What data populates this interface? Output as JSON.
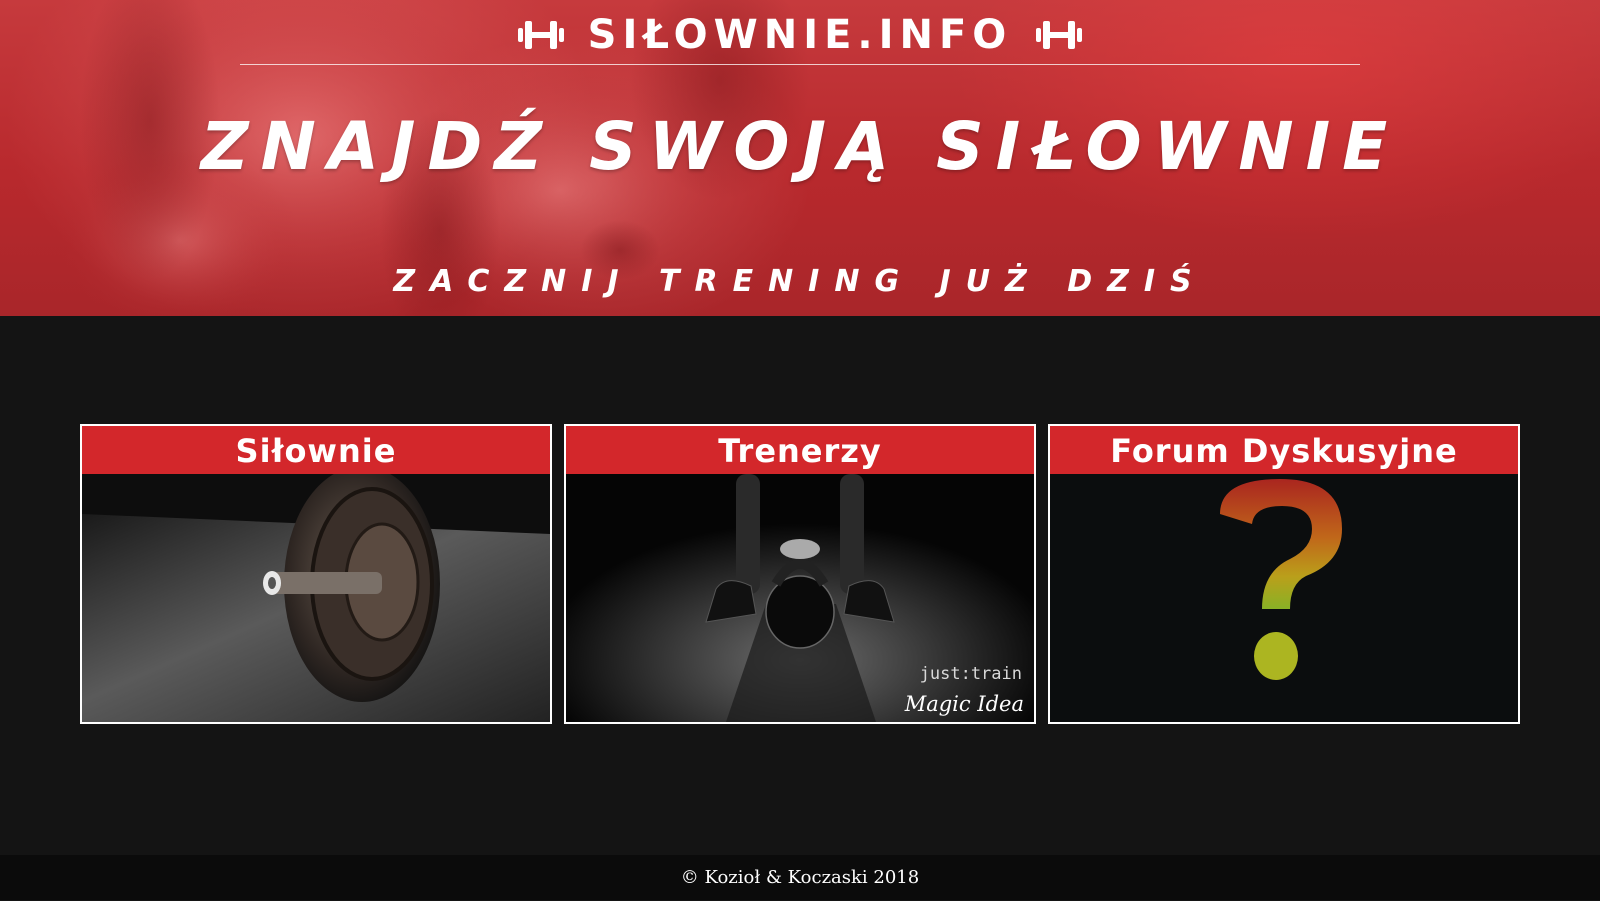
{
  "header": {
    "brand": "SIŁOWNIE.INFO",
    "brand_icon_left": "dumbbell-icon",
    "brand_icon_right": "dumbbell-icon",
    "title": "ZNAJDŹ SWOJĄ SIŁOWNIE",
    "subtitle": "ZACZNIJ TRENING JUŻ DZIŚ"
  },
  "cards": [
    {
      "title": "Siłownie",
      "image": "weight-plate-photo"
    },
    {
      "title": "Trenerzy",
      "image": "kettlebell-photo",
      "watermark_top": "just:train",
      "watermark_bottom": "Magic Idea"
    },
    {
      "title": "Forum Dyskusyjne",
      "image": "question-mark-word-cloud"
    }
  ],
  "footer": {
    "text": "© Kozioł & Koczaski 2018"
  },
  "colors": {
    "accent_red": "#d3272b",
    "hero_red": "#b8292d",
    "background": "#141414",
    "footer_bg": "#0b0b0b"
  }
}
